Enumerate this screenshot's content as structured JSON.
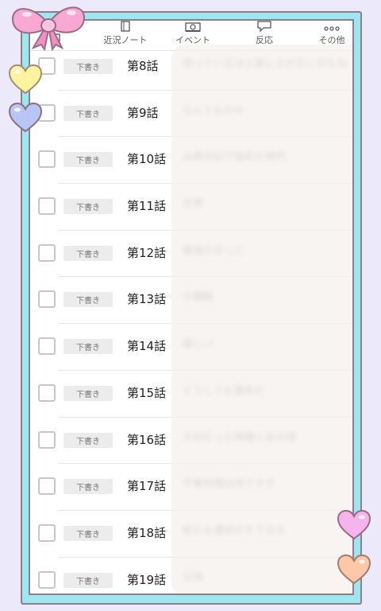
{
  "nav": {
    "items": [
      {
        "label": "",
        "icon": "document-icon"
      },
      {
        "label": "近況ノート",
        "icon": "notebook-icon"
      },
      {
        "label": "イベント",
        "icon": "photo-icon"
      },
      {
        "label": "反応",
        "icon": "speech-bubble-icon"
      },
      {
        "label": "その他",
        "icon": "dots-icon"
      }
    ]
  },
  "episodes": [
    {
      "status": "下書き",
      "title": "第8話",
      "subtitle": "思っているほど楽しさがないかもね"
    },
    {
      "status": "下書き",
      "title": "第9話",
      "subtitle": "なんでなのか"
    },
    {
      "status": "下書き",
      "title": "第10話",
      "subtitle": "山奥日記で始めた時代"
    },
    {
      "status": "下書き",
      "title": "第11話",
      "subtitle": "日常"
    },
    {
      "status": "下書き",
      "title": "第12話",
      "subtitle": "最後のゆっと"
    },
    {
      "status": "下書き",
      "title": "第13話",
      "subtitle": "大騒動"
    },
    {
      "status": "下書き",
      "title": "第14話",
      "subtitle": "嬉しい"
    },
    {
      "status": "下書き",
      "title": "第15話",
      "subtitle": "どうしても運命だ"
    },
    {
      "status": "下書き",
      "title": "第16話",
      "subtitle": "大切だった時間とあの頃"
    },
    {
      "status": "下書き",
      "title": "第17話",
      "subtitle": "午後時間は何ですか"
    },
    {
      "status": "下書き",
      "title": "第18話",
      "subtitle": "新たな運命がそうなる"
    },
    {
      "status": "下書き",
      "title": "第19話",
      "subtitle": "日常"
    }
  ],
  "colors": {
    "frame": "#9fe5f2",
    "background": "#ece9fb",
    "bow": "#f7a9d4",
    "heart_yellow": "#fff3a0",
    "heart_blue": "#b9c6f5",
    "heart_pink": "#f5b4ee",
    "heart_peach": "#fcc8a8"
  }
}
